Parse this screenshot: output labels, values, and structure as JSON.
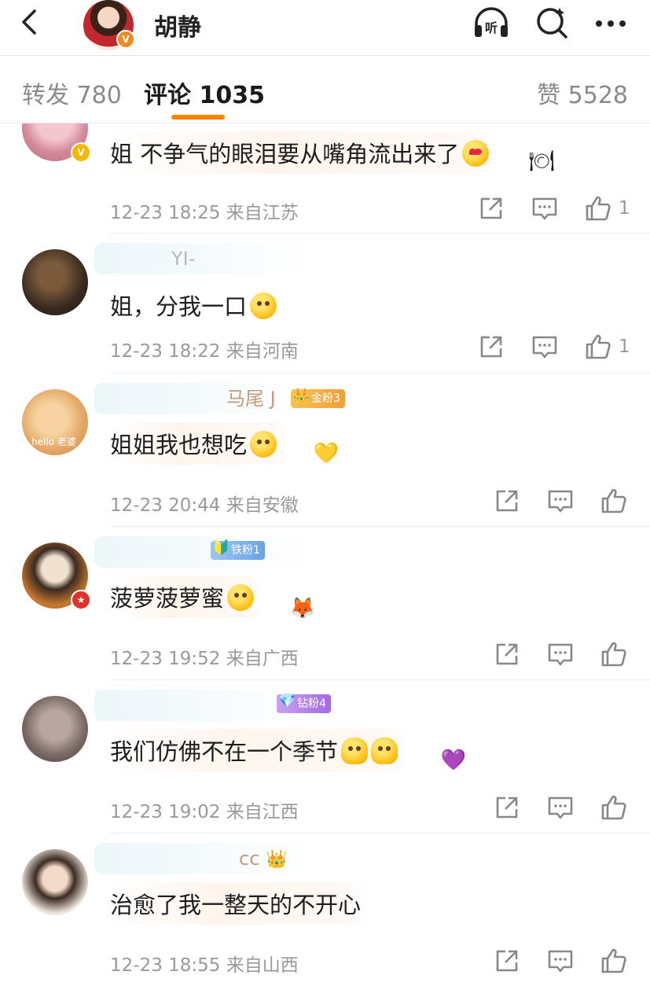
{
  "header": {
    "author_name": "胡静",
    "verified_badge": "V"
  },
  "tabs": {
    "reposts": "转发 780",
    "comments": "评论 1035",
    "likes": "赞 5528"
  },
  "comments": [
    {
      "text": "姐 不争气的眼泪要从嘴角流出来了",
      "time": "12-23 18:25",
      "location": "来自江苏",
      "likes": "1"
    },
    {
      "username": "YI-",
      "text": "姐，分我一口",
      "time": "12-23 18:22",
      "location": "来自河南",
      "likes": "1"
    },
    {
      "username": "马尾 J",
      "fan_badge": "金粉3",
      "avatar_text": "hello 老婆",
      "text": "姐姐我也想吃",
      "time": "12-23 20:44",
      "location": "来自安徽",
      "likes": ""
    },
    {
      "fan_badge": "铁粉1",
      "text": "菠萝菠萝蜜",
      "time": "12-23 19:52",
      "location": "来自广西",
      "likes": ""
    },
    {
      "fan_badge": "钻粉4",
      "text": "我们仿佛不在一个季节",
      "time": "12-23 19:02",
      "location": "来自江西",
      "likes": ""
    },
    {
      "username": "cc",
      "text": "治愈了我一整天的不开心",
      "time": "12-23 18:55",
      "location": "来自山西",
      "likes": ""
    }
  ],
  "colors": {
    "accent": "#ff8200",
    "meta_gray": "#999999"
  },
  "icons": {
    "back": "chevron-left-icon",
    "listen": "headphones-icon",
    "search": "search-icon",
    "more": "more-dots-icon",
    "share": "share-icon",
    "comment": "comment-icon",
    "like": "thumbs-up-icon"
  }
}
